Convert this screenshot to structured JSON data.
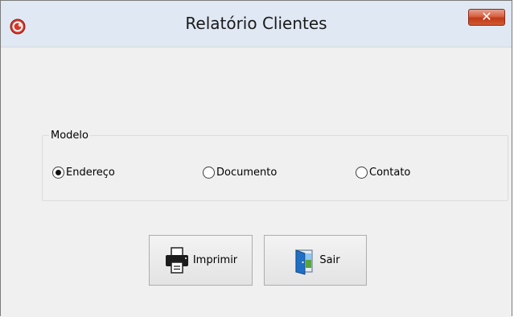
{
  "window": {
    "title": "Relatório Clientes",
    "close_label": "✕"
  },
  "group": {
    "legend": "Modelo",
    "options": [
      {
        "label": "Endereço",
        "selected": true
      },
      {
        "label": "Documento",
        "selected": false
      },
      {
        "label": "Contato",
        "selected": false
      }
    ]
  },
  "buttons": {
    "print_label": "Imprimir",
    "exit_label": "Sair"
  }
}
